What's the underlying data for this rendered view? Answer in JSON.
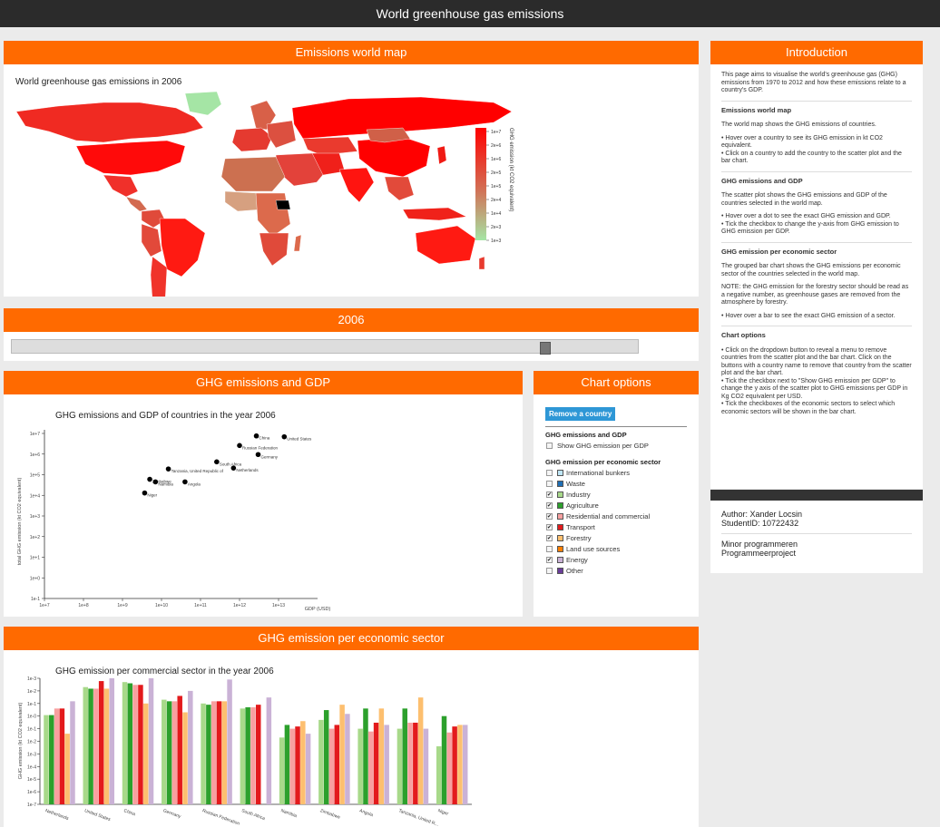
{
  "app": {
    "title": "World greenhouse gas emissions"
  },
  "map": {
    "header": "Emissions world map",
    "title": "World greenhouse gas emissions in 2006",
    "legend_label": "GHG emission (kt CO2 equivalent)",
    "legend_ticks": [
      "1e+7",
      "2e+6",
      "1e+6",
      "2e+5",
      "1e+5",
      "2e+4",
      "1e+4",
      "2e+3",
      "1e+3"
    ]
  },
  "year": {
    "label": "2006",
    "value": 2006,
    "min": 1970,
    "max": 2012
  },
  "ghg": {
    "header": "GHG emissions and GDP",
    "title": "GHG emissions and GDP of countries in the year 2006",
    "ylabel": "total GHG emission (kt CO2 equivalent)",
    "xlabel": "GDP (USD)"
  },
  "options": {
    "header": "Chart options",
    "remove_button": "Remove a country",
    "section1": "GHG emissions and GDP",
    "gdp_checkbox": "Show GHG emission per GDP",
    "section2": "GHG emission per economic sector",
    "sectors": [
      {
        "label": "International bunkers",
        "checked": false,
        "color": "#bfe6f7"
      },
      {
        "label": "Waste",
        "checked": false,
        "color": "#1f6fb5"
      },
      {
        "label": "Industry",
        "checked": true,
        "color": "#a8d98a"
      },
      {
        "label": "Agriculture",
        "checked": true,
        "color": "#2ca02c"
      },
      {
        "label": "Residential and commercial",
        "checked": true,
        "color": "#f8a0a0"
      },
      {
        "label": "Transport",
        "checked": true,
        "color": "#e31a1c"
      },
      {
        "label": "Forestry",
        "checked": true,
        "color": "#fdbf6f"
      },
      {
        "label": "Land use sources",
        "checked": false,
        "color": "#ff7f00"
      },
      {
        "label": "Energy",
        "checked": true,
        "color": "#cab2d6"
      },
      {
        "label": "Other",
        "checked": false,
        "color": "#6a3d9a"
      }
    ]
  },
  "sector": {
    "header": "GHG emission per economic sector",
    "title": "GHG emission per commercial sector in the year 2006",
    "ylabel": "GHG emission (kt CO2 equivalent)"
  },
  "intro": {
    "header": "Introduction",
    "p1": "This page aims to visualise the world's greenhouse gas (GHG) emissions from 1970 to 2012 and how these emissions relate to a country's GDP.",
    "h_map": "Emissions world map",
    "map_p": "The world map shows the GHG emissions of countries.",
    "map_b1": "•   Hover over a country to see its GHG emission in kt CO2 equivalent.",
    "map_b2": "•   Click on a country to add the country to the scatter plot and the bar chart.",
    "h_gdp": "GHG emissions and GDP",
    "gdp_p": "The scatter plot shows the GHG emissions and GDP of the countries selected in the world map.",
    "gdp_b1": "•   Hover over a dot to see the exact GHG emission and GDP.",
    "gdp_b2": "•   Tick the checkbox to change the y-axis from GHG emission to GHG emission per GDP.",
    "h_sector": "GHG emission per economic sector",
    "sector_p": "The grouped bar chart shows the GHG emissions per economic sector of the countries selected in the world map.",
    "sector_note": "NOTE: the GHG emission for the forestry sector should be read as a negative number, as greenhouse gases are removed from the atmosphere by forestry.",
    "sector_b1": "•   Hover over a bar to see the exact GHG emission of a sector.",
    "h_options": "Chart options",
    "opt_b1": "•   Click on the dropdown button to reveal a menu to remove countries from the scatter plot and the bar chart. Click on the buttons with a country name to remove that country from the scatter plot and the bar chart.",
    "opt_b2": "•   Tick the checkbox next to \"Show GHG emission per GDP\" to change the y axis of the scatter plot to GHG emissions per GDP in Kg CO2 equivalent per USD.",
    "opt_b3": "•   Tick the checkboxes of the economic sectors to select which economic sectors will be shown in the bar chart."
  },
  "author": {
    "name": "Author: Xander Locsin",
    "student": "StudentID: 10722432",
    "course1": "Minor programmeren",
    "course2": "Programmeerproject"
  },
  "chart_data": [
    {
      "type": "scatter",
      "title": "GHG emissions and GDP of countries in the year 2006",
      "xlabel": "GDP (USD)",
      "ylabel": "total GHG emission (kt CO2 equivalent)",
      "xscale": "log",
      "yscale": "log",
      "xlim": [
        10000000.0,
        100000000000000.0
      ],
      "ylim": [
        0.1,
        10000000.0
      ],
      "x_ticks": [
        "1e+7",
        "1e+8",
        "1e+9",
        "1e+10",
        "1e+11",
        "1e+12",
        "1e+13"
      ],
      "y_ticks": [
        "1e+7",
        "1e+6",
        "1e+5",
        "1e+4",
        "1e+3",
        "1e+2",
        "1e+1",
        "1e+0",
        "1e-1"
      ],
      "points": [
        {
          "label": "China",
          "x": 2700000000000.0,
          "y": 7600000.0
        },
        {
          "label": "United States",
          "x": 14000000000000.0,
          "y": 6900000.0
        },
        {
          "label": "Russian Federation",
          "x": 1000000000000.0,
          "y": 2600000.0
        },
        {
          "label": "Germany",
          "x": 3000000000000.0,
          "y": 950000.0
        },
        {
          "label": "South Africa",
          "x": 260000000000.0,
          "y": 420000.0
        },
        {
          "label": "Netherlands",
          "x": 700000000000.0,
          "y": 210000.0
        },
        {
          "label": "Tanzania, United Republic of",
          "x": 15000000000.0,
          "y": 190000.0
        },
        {
          "label": "Zimbabwe",
          "x": 5000000000.0,
          "y": 60000.0
        },
        {
          "label": "Namibia",
          "x": 7000000000.0,
          "y": 45000.0
        },
        {
          "label": "Angola",
          "x": 40000000000.0,
          "y": 45000.0
        },
        {
          "label": "Niger",
          "x": 3700000000.0,
          "y": 13000.0
        }
      ]
    },
    {
      "type": "bar",
      "title": "GHG emission per commercial sector in the year 2006",
      "ylabel": "GHG emission (kt CO2 equivalent)",
      "yscale": "log",
      "ylim": [
        1e-07,
        1000.0
      ],
      "y_ticks": [
        "1e-3",
        "1e-2",
        "1e-1",
        "1e-0",
        "1e-1",
        "1e-2",
        "1e-3",
        "1e-4",
        "1e-5",
        "1e-6",
        "1e-7"
      ],
      "categories": [
        "Netherlands",
        "United States",
        "China",
        "Germany",
        "Russian Federation",
        "South Africa",
        "Namibia",
        "Zimbabwe",
        "Angola",
        "Tanzania, United R...",
        "Niger"
      ],
      "series": [
        {
          "name": "Industry",
          "color": "#a8d98a",
          "values": [
            1.2,
            200.0,
            500.0,
            20.0,
            10.0,
            4.0,
            0.02,
            0.5,
            0.1,
            0.1,
            0.004
          ]
        },
        {
          "name": "Agriculture",
          "color": "#2ca02c",
          "values": [
            1.2,
            150.0,
            400.0,
            15.0,
            8.0,
            5.0,
            0.2,
            3.0,
            4.0,
            4.0,
            1.0
          ]
        },
        {
          "name": "Residential and commercial",
          "color": "#f8a0a0",
          "values": [
            4.0,
            150.0,
            300.0,
            15.0,
            15.0,
            5.0,
            0.1,
            0.1,
            0.06,
            0.3,
            0.05
          ]
        },
        {
          "name": "Transport",
          "color": "#e31a1c",
          "values": [
            4.0,
            600.0,
            300.0,
            40.0,
            15.0,
            8.0,
            0.15,
            0.2,
            0.3,
            0.3,
            0.15
          ]
        },
        {
          "name": "Forestry",
          "color": "#fdbf6f",
          "values": [
            0.04,
            150.0,
            10.0,
            2.0,
            15.0,
            0,
            0.4,
            8.0,
            4.0,
            30.0,
            0.2
          ]
        },
        {
          "name": "Energy",
          "color": "#cab2d6",
          "values": [
            15.0,
            1200.0,
            1500.0,
            100.0,
            800.0,
            30.0,
            0.04,
            1.5,
            0.2,
            0.1,
            0.2
          ]
        }
      ]
    },
    {
      "type": "heatmap",
      "title": "World greenhouse gas emissions in 2006",
      "legend_label": "GHG emission (kt CO2 equivalent)",
      "color_range": [
        "#ff0000",
        "#a5e5a5"
      ]
    }
  ]
}
